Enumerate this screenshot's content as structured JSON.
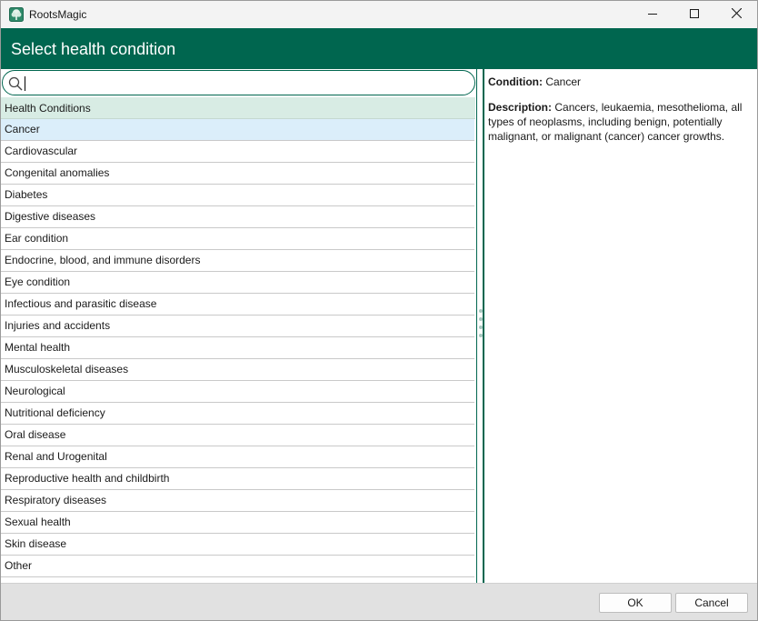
{
  "window": {
    "title": "RootsMagic"
  },
  "dialog": {
    "title": "Select health condition"
  },
  "search": {
    "value": "",
    "placeholder": ""
  },
  "list": {
    "header": "Health Conditions",
    "items": [
      "Cancer",
      "Cardiovascular",
      "Congenital anomalies",
      "Diabetes",
      "Digestive diseases",
      "Ear condition",
      "Endocrine, blood, and immune disorders",
      "Eye condition",
      "Infectious and parasitic disease",
      "Injuries and accidents",
      "Mental health",
      "Musculoskeletal diseases",
      "Neurological",
      "Nutritional deficiency",
      "Oral disease",
      "Renal and Urogenital",
      "Reproductive health and childbirth",
      "Respiratory diseases",
      "Sexual health",
      "Skin disease",
      "Other"
    ],
    "selected": "Cancer"
  },
  "detail": {
    "condition_label": "Condition:",
    "condition_value": "Cancer",
    "description_label": "Description:",
    "description_value": "Cancers, leukaemia, mesothelioma, all types of neoplasms, including benign, potentially malignant, or malignant (cancer) cancer growths."
  },
  "buttons": {
    "ok": "OK",
    "cancel": "Cancel"
  },
  "colors": {
    "header_green": "#00664f",
    "selection": "#dbeefa",
    "list_header": "#d8ece4"
  }
}
